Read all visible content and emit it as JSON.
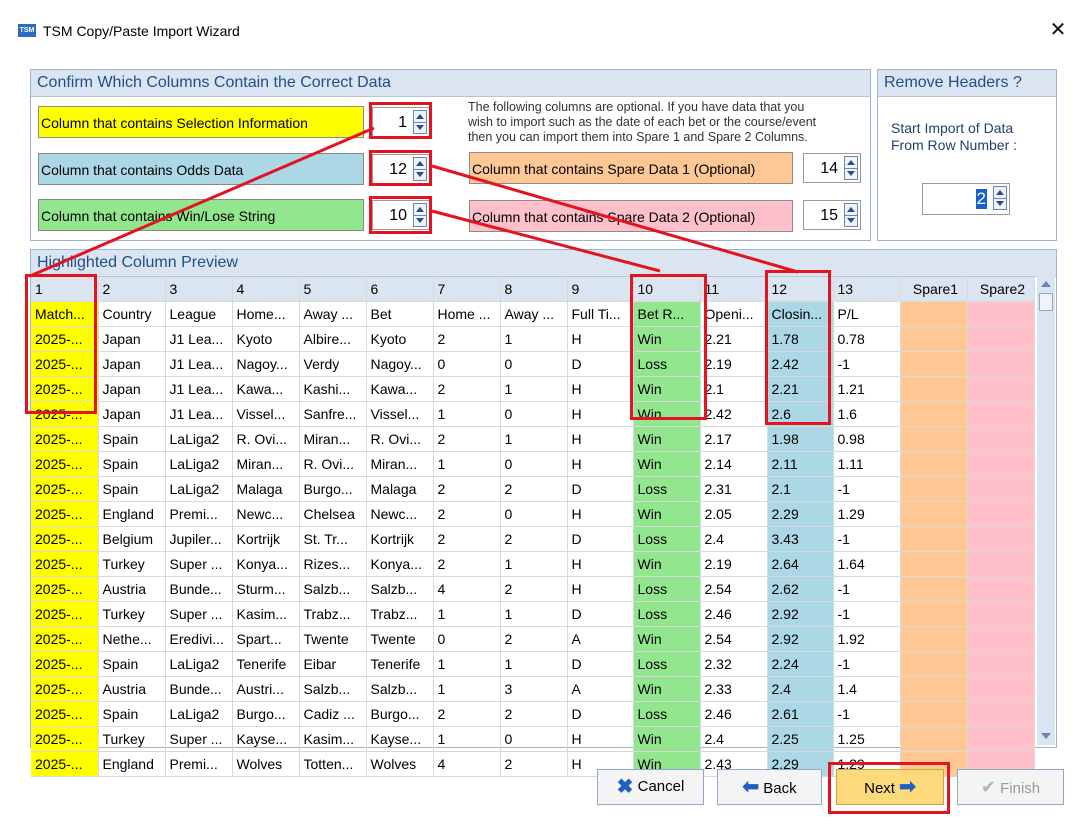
{
  "window": {
    "title": "TSM Copy/Paste Import Wizard",
    "icon_label": "TSM",
    "close_glyph": "✕"
  },
  "confirm_panel": {
    "header": "Confirm Which Columns Contain the Correct Data",
    "selection": {
      "label": "Column that contains Selection Information",
      "value": "1",
      "color": "#ffff00"
    },
    "odds": {
      "label": "Column that contains Odds Data",
      "value": "12",
      "color": "#acd7e5"
    },
    "winlose": {
      "label": "Column that contains Win/Lose String",
      "value": "10",
      "color": "#92e68d"
    },
    "optional_note_lines": [
      "The following columns are optional. If you have data that you",
      "wish to import such as the date of each bet or the course/event",
      "then you can import them into Spare 1 and Spare 2 Columns."
    ],
    "spare1": {
      "label": "Column that contains Spare Data 1 (Optional)",
      "value": "14",
      "color": "#ffc794"
    },
    "spare2": {
      "label": "Column that contains Spare Data 2 (Optional)",
      "value": "15",
      "color": "#ffc0cb"
    }
  },
  "headers_panel": {
    "header": "Remove Headers ?",
    "text_lines": [
      "Start Import of Data",
      "From Row Number :"
    ],
    "value": "2"
  },
  "preview": {
    "header": "Highlighted Column Preview",
    "columns": [
      "1",
      "2",
      "3",
      "4",
      "5",
      "6",
      "7",
      "8",
      "9",
      "10",
      "11",
      "12",
      "13",
      "Spare1",
      "Spare2"
    ],
    "rows": [
      [
        "Match...",
        "Country",
        "League",
        "Home...",
        "Away ...",
        "Bet",
        "Home ...",
        "Away ...",
        "Full Ti...",
        "Bet R...",
        "Openi...",
        "Closin...",
        "P/L",
        "",
        ""
      ],
      [
        "2025-...",
        "Japan",
        "J1 Lea...",
        "Kyoto",
        "Albire...",
        "Kyoto",
        "2",
        "1",
        "H",
        "Win",
        "2.21",
        "1.78",
        "0.78",
        "",
        ""
      ],
      [
        "2025-...",
        "Japan",
        "J1 Lea...",
        "Nagoy...",
        "Verdy",
        "Nagoy...",
        "0",
        "0",
        "D",
        "Loss",
        "2.19",
        "2.42",
        "-1",
        "",
        ""
      ],
      [
        "2025-...",
        "Japan",
        "J1 Lea...",
        "Kawa...",
        "Kashi...",
        "Kawa...",
        "2",
        "1",
        "H",
        "Win",
        "2.1",
        "2.21",
        "1.21",
        "",
        ""
      ],
      [
        "2025-...",
        "Japan",
        "J1 Lea...",
        "Vissel...",
        "Sanfre...",
        "Vissel...",
        "1",
        "0",
        "H",
        "Win",
        "2.42",
        "2.6",
        "1.6",
        "",
        ""
      ],
      [
        "2025-...",
        "Spain",
        "LaLiga2",
        "R. Ovi...",
        "Miran...",
        "R. Ovi...",
        "2",
        "1",
        "H",
        "Win",
        "2.17",
        "1.98",
        "0.98",
        "",
        ""
      ],
      [
        "2025-...",
        "Spain",
        "LaLiga2",
        "Miran...",
        "R. Ovi...",
        "Miran...",
        "1",
        "0",
        "H",
        "Win",
        "2.14",
        "2.11",
        "1.11",
        "",
        ""
      ],
      [
        "2025-...",
        "Spain",
        "LaLiga2",
        "Malaga",
        "Burgo...",
        "Malaga",
        "2",
        "2",
        "D",
        "Loss",
        "2.31",
        "2.1",
        "-1",
        "",
        ""
      ],
      [
        "2025-...",
        "England",
        "Premi...",
        "Newc...",
        "Chelsea",
        "Newc...",
        "2",
        "0",
        "H",
        "Win",
        "2.05",
        "2.29",
        "1.29",
        "",
        ""
      ],
      [
        "2025-...",
        "Belgium",
        "Jupiler...",
        "Kortrijk",
        "St. Tr...",
        "Kortrijk",
        "2",
        "2",
        "D",
        "Loss",
        "2.4",
        "3.43",
        "-1",
        "",
        ""
      ],
      [
        "2025-...",
        "Turkey",
        "Super ...",
        "Konya...",
        "Rizes...",
        "Konya...",
        "2",
        "1",
        "H",
        "Win",
        "2.19",
        "2.64",
        "1.64",
        "",
        ""
      ],
      [
        "2025-...",
        "Austria",
        "Bunde...",
        "Sturm...",
        "Salzb...",
        "Salzb...",
        "4",
        "2",
        "H",
        "Loss",
        "2.54",
        "2.62",
        "-1",
        "",
        ""
      ],
      [
        "2025-...",
        "Turkey",
        "Super ...",
        "Kasim...",
        "Trabz...",
        "Trabz...",
        "1",
        "1",
        "D",
        "Loss",
        "2.46",
        "2.92",
        "-1",
        "",
        ""
      ],
      [
        "2025-...",
        "Nethe...",
        "Eredivi...",
        "Spart...",
        "Twente",
        "Twente",
        "0",
        "2",
        "A",
        "Win",
        "2.54",
        "2.92",
        "1.92",
        "",
        ""
      ],
      [
        "2025-...",
        "Spain",
        "LaLiga2",
        "Tenerife",
        "Eibar",
        "Tenerife",
        "1",
        "1",
        "D",
        "Loss",
        "2.32",
        "2.24",
        "-1",
        "",
        ""
      ],
      [
        "2025-...",
        "Austria",
        "Bunde...",
        "Austri...",
        "Salzb...",
        "Salzb...",
        "1",
        "3",
        "A",
        "Win",
        "2.33",
        "2.4",
        "1.4",
        "",
        ""
      ],
      [
        "2025-...",
        "Spain",
        "LaLiga2",
        "Burgo...",
        "Cadiz ...",
        "Burgo...",
        "2",
        "2",
        "D",
        "Loss",
        "2.46",
        "2.61",
        "-1",
        "",
        ""
      ],
      [
        "2025-...",
        "Turkey",
        "Super ...",
        "Kayse...",
        "Kasim...",
        "Kayse...",
        "1",
        "0",
        "H",
        "Win",
        "2.4",
        "2.25",
        "1.25",
        "",
        ""
      ],
      [
        "2025-...",
        "England",
        "Premi...",
        "Wolves",
        "Totten...",
        "Wolves",
        "4",
        "2",
        "H",
        "Win",
        "2.43",
        "2.29",
        "1.29",
        "",
        ""
      ]
    ]
  },
  "buttons": {
    "cancel": "Cancel",
    "back": "Back",
    "next": "Next",
    "finish": "Finish"
  },
  "colors": {
    "accent": "#1f4e8f",
    "highlight_red": "#e3131f"
  }
}
